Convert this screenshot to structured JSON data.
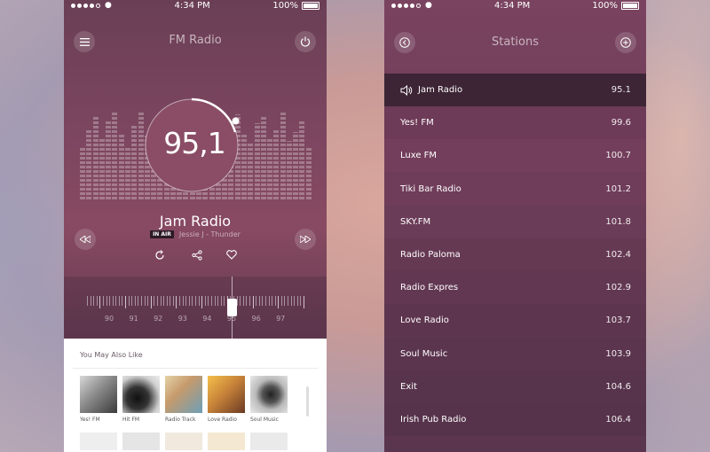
{
  "status_bar": {
    "time": "4:34 PM",
    "battery": "100%"
  },
  "player": {
    "title": "FM Radio",
    "frequency": "95,1",
    "station": "Jam Radio",
    "on_air_badge": "IN AIR",
    "track": "Jessie J - Thunder",
    "tuner_labels": [
      "90",
      "91",
      "92",
      "93",
      "94",
      "95",
      "96",
      "97"
    ],
    "icons": {
      "menu": "hamburger-icon",
      "power": "power-icon",
      "previous": "rewind-icon",
      "next": "fast-forward-icon",
      "repeat": "repeat-icon",
      "share": "share-icon",
      "favorite": "heart-icon"
    }
  },
  "suggestions": {
    "heading": "You May Also Like",
    "items": [
      {
        "label": "Yes! FM"
      },
      {
        "label": "Hit FM"
      },
      {
        "label": "Radio Track"
      },
      {
        "label": "Love Radio"
      },
      {
        "label": "Soul Music"
      }
    ]
  },
  "stations_screen": {
    "title": "Stations",
    "stations": [
      {
        "name": "Jam Radio",
        "freq": "95.1",
        "active": true
      },
      {
        "name": "Yes! FM",
        "freq": "99.6"
      },
      {
        "name": "Luxe FM",
        "freq": "100.7"
      },
      {
        "name": "Tiki Bar Radio",
        "freq": "101.2"
      },
      {
        "name": "SKY.FM",
        "freq": "101.8"
      },
      {
        "name": "Radio Paloma",
        "freq": "102.4"
      },
      {
        "name": "Radio Expres",
        "freq": "102.9"
      },
      {
        "name": "Love Radio",
        "freq": "103.7"
      },
      {
        "name": "Soul Music",
        "freq": "103.9"
      },
      {
        "name": "Exit",
        "freq": "104.6"
      },
      {
        "name": "Irish Pub Radio",
        "freq": "106.4"
      }
    ]
  },
  "colors": {
    "accent": "#884a62",
    "active_row": "#3d2535"
  }
}
